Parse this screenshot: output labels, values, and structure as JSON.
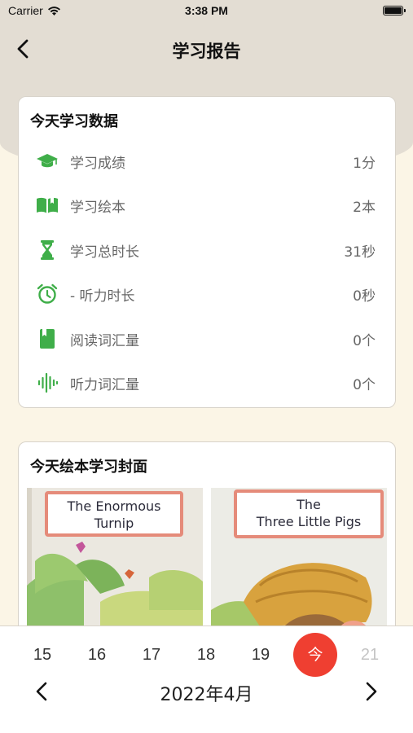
{
  "status_bar": {
    "carrier": "Carrier",
    "time": "3:38 PM"
  },
  "nav": {
    "title": "学习报告"
  },
  "stats_card": {
    "title": "今天学习数据",
    "rows": [
      {
        "icon": "graduation-cap-icon",
        "label": "学习成绩",
        "value": "1分"
      },
      {
        "icon": "open-book-icon",
        "label": "学习绘本",
        "value": "2本"
      },
      {
        "icon": "hourglass-icon",
        "label": "学习总时长",
        "value": "31秒"
      },
      {
        "icon": "alarm-clock-icon",
        "label": "- 听力时长",
        "value": "0秒"
      },
      {
        "icon": "book-icon",
        "label": "阅读词汇量",
        "value": "0个"
      },
      {
        "icon": "soundwave-icon",
        "label": "听力词汇量",
        "value": "0个"
      }
    ]
  },
  "covers_card": {
    "title": "今天绘本学习封面",
    "books": [
      {
        "title_line1": "The Enormous",
        "title_line2": "Turnip"
      },
      {
        "title_line1": "The",
        "title_line2": "Three Little Pigs"
      }
    ]
  },
  "date_picker": {
    "days": [
      "15",
      "16",
      "17",
      "18",
      "19",
      "今",
      "21"
    ],
    "selected": "今",
    "month": "2022年4月"
  },
  "colors": {
    "accent_green": "#3fae49",
    "today_red": "#ef3f31",
    "header_bg": "#e3ddd3",
    "page_bg": "#fbf5e6"
  }
}
